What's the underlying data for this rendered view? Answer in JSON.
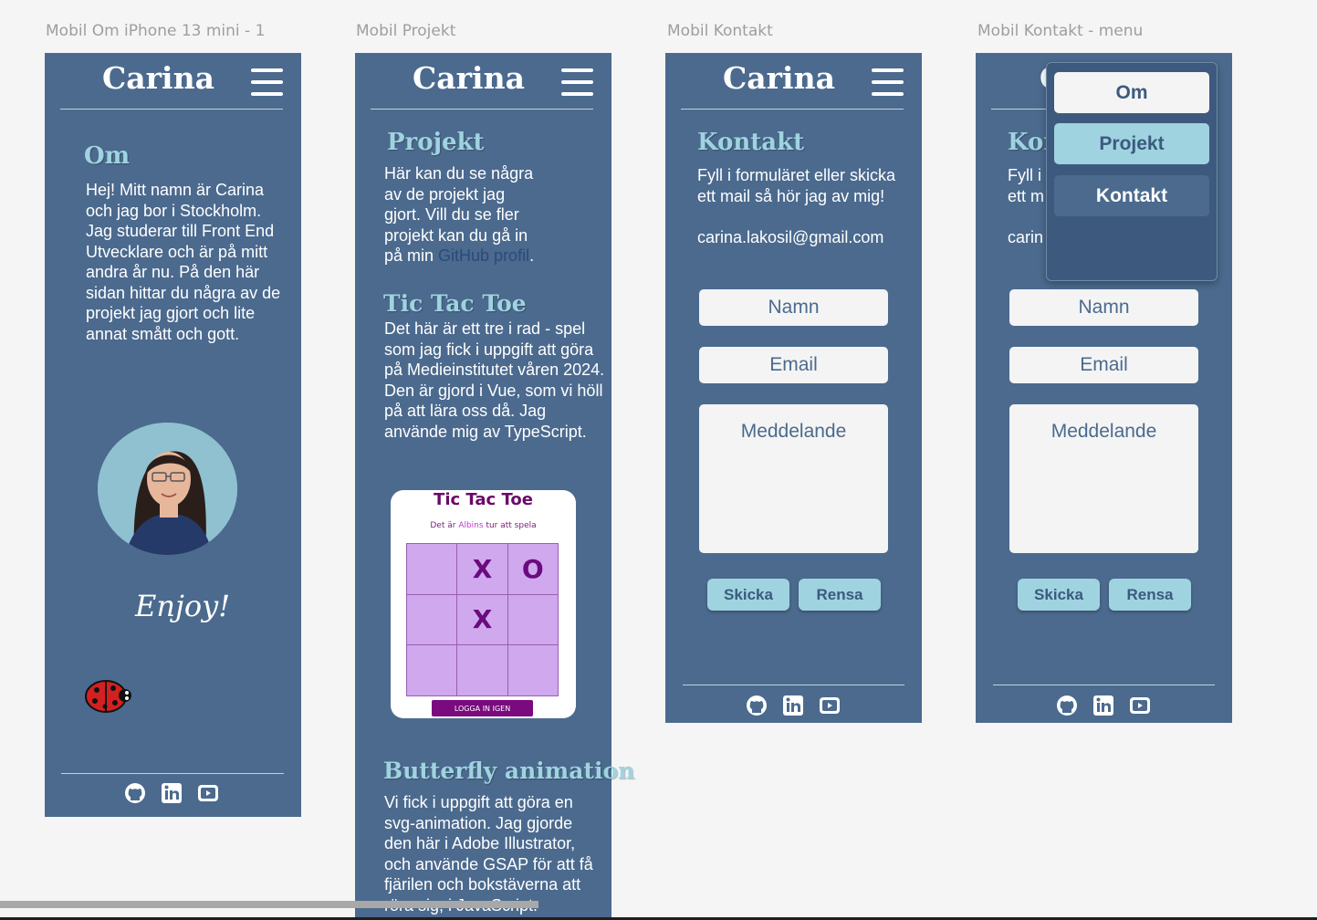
{
  "frames": [
    {
      "label": "Mobil Om iPhone 13 mini - 1"
    },
    {
      "label": "Mobil Projekt"
    },
    {
      "label": "Mobil Kontakt"
    },
    {
      "label": "Mobil Kontakt - menu"
    }
  ],
  "header": {
    "title": "Carina"
  },
  "om": {
    "heading": "Om",
    "text": "Hej! Mitt namn är Carina och jag bor i Stockholm. Jag studerar till Front End Utvecklare och är på mitt andra år nu. På den här sidan hittar du några av de projekt jag gjort och lite annat smått och gott.",
    "signature": "Enjoy!"
  },
  "projekt": {
    "heading": "Projekt",
    "intro_lines": [
      "Här kan du se några",
      "av de projekt  jag",
      "gjort. Vill du se fler",
      "projekt kan du gå in"
    ],
    "intro_last_prefix": "på min ",
    "intro_link": "GitHub profil",
    "intro_last_suffix": ".",
    "ttt_heading": "Tic Tac Toe",
    "ttt_text": "Det här är ett tre i rad - spel som jag fick i uppgift att göra på Medieinstitutet våren 2024. Den är gjord i Vue, som vi höll på att lära oss då. Jag använde mig av TypeScript.",
    "ttt_card": {
      "title": "Tic Tac Toe",
      "turn_prefix": "Det är ",
      "turn_name": "Albins",
      "turn_suffix": " tur att spela",
      "cells": [
        "",
        "X",
        "O",
        "",
        "X",
        "",
        "",
        "",
        ""
      ],
      "button": "LOGGA IN IGEN"
    },
    "butterfly_heading": "Butterfly animation",
    "butterfly_text": "Vi fick i uppgift att göra en svg-animation. Jag gjorde den här i Adobe Illustrator, och använde GSAP för att få fjärilen och bokstäverna att röra sig, i JavaScript."
  },
  "kontakt": {
    "heading": "Kontakt",
    "text": "Fyll i formuläret eller skicka ett mail så hör jag av mig!",
    "email": "carina.lakosil@gmail.com",
    "name_placeholder": "Namn",
    "email_placeholder": "Email",
    "message_placeholder": "Meddelande",
    "send_label": "Skicka",
    "clear_label": "Rensa"
  },
  "kontakt_menu": {
    "heading_partial": "Kor",
    "text_partial_1": "Fyll i",
    "text_partial_2": "ett m",
    "email_partial": "carin",
    "header_partial": "C"
  },
  "menu": {
    "items": [
      {
        "label": "Om",
        "bg": "#f4f4f4",
        "fg": "#3b5a7e"
      },
      {
        "label": "Projekt",
        "bg": "#9fd3e0",
        "fg": "#3b5a7e"
      },
      {
        "label": "Kontakt",
        "bg": "#4b6a8e",
        "fg": "#ffffff"
      }
    ]
  },
  "footer": {
    "icons": [
      "github-icon",
      "linkedin-icon",
      "youtube-icon"
    ]
  },
  "colors": {
    "frame_bg": "#4b6a8e",
    "accent": "#9fd3e0",
    "canvas": "#f5f5f5"
  }
}
